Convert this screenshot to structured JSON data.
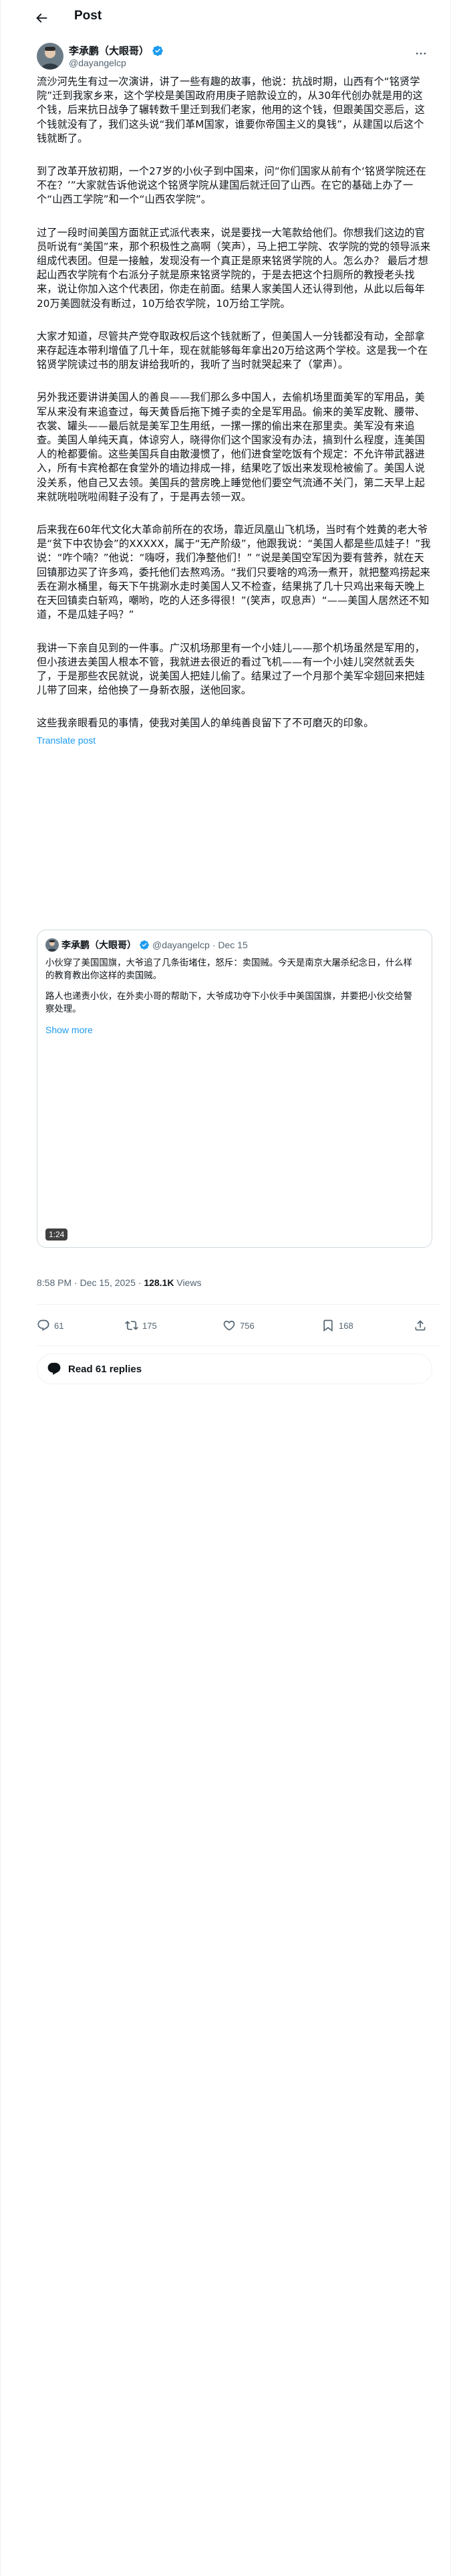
{
  "topbar": {
    "title": "Post"
  },
  "author": {
    "name": "李承鹏（大眼哥）",
    "handle": "@dayangelcp"
  },
  "post": {
    "paragraphs": [
      "流沙河先生有过一次演讲，讲了一些有趣的故事，他说：抗战时期，山西有个“铭贤学院”迁到我家乡来，这个学校是美国政府用庚子赔款设立的，从30年代创办就是用的这个钱，后来抗日战争了辗转数千里迁到我们老家，他用的这个钱，但跟美国交恶后，这个钱就没有了，我们这头说“我们革M国家，谁要你帝国主义的臭钱”，从建国以后这个钱就断了。",
      "到了改革开放初期，一个27岁的小伙子到中国来，问“你们国家从前有个‘铭贤学院还在不在？’”大家就告诉他说这个铭贤学院从建国后就迁回了山西。在它的基础上办了一个“山西工学院”和一个“山西农学院”。",
      "过了一段时间美国方面就正式派代表来，说是要找一大笔款给他们。你想我们这边的官员听说有“美国”来，那个积极性之高啊（笑声），马上把工学院、农学院的党的领导派来组成代表团。但是一接触，发现没有一个真正是原来铭贤学院的人。怎么办？ 最后才想起山西农学院有个右派分子就是原来铭贤学院的，于是去把这个扫厕所的教授老头找来，说让你加入这个代表团，你走在前面。结果人家美国人还认得到他，从此以后每年20万美圆就没有断过，10万给农学院，10万给工学院。",
      "大家才知道，尽管共产党夺取政权后这个钱就断了，但美国人一分钱都没有动，全部拿来存起连本带利增值了几十年，现在就能够每年拿出20万给这两个学校。这是我一个在铭贤学院读过书的朋友讲给我听的，我听了当时就哭起来了（掌声）。",
      "另外我还要讲讲美国人的善良——我们那么多中国人，去偷机场里面美军的军用品，美军从来没有来追查过，每天黄昏后拖下摊子卖的全是军用品。偷来的美军皮靴、腰带、衣裳、罐头——最后就是美军卫生用纸，一摞一摞的偷出来在那里卖。美军没有来追查。美国人单纯天真，体谅穷人，晓得你们这个国家没有办法，搞到什么程度，连美国人的枪都要偷。这些美国兵自由散漫惯了，他们进食堂吃饭有个规定：不允许带武器进入，所有卡宾枪都在食堂外的墙边排成一排，结果吃了饭出来发现枪被偷了。美国人说没关系，他自己又去领。美国兵的营房晚上睡觉他们要空气流通不关门，第二天早上起来就咣啦咣啦闹鞋子没有了，于是再去领一双。",
      "后来我在60年代文化大革命前所在的农场，靠近凤凰山飞机场，当时有个姓黄的老大爷是“贫下中农协会”的XXXXX，属于“无产阶级”，他跟我说：“美国人都是些瓜娃子！”我说：“咋个喃？”他说：“嗨呀，我们净整他们！” “说是美国空军因为要有营养，就在天回镇那边买了许多鸡，委托他们去熬鸡汤。“我们只要啥的鸡汤一煮开，就把整鸡捞起来丢在涮水桶里，每天下午挑涮水走时美国人又不检查，结果挑了几十只鸡出来每天晚上在天回镇卖白斩鸡，嘲哟，吃的人还多得很！”(笑声，叹息声）“——美国人居然还不知道，不是瓜娃子吗？”",
      "我讲一下亲自见到的一件事。广汉机场那里有一个小娃儿——那个机场虽然是军用的，但小孩进去美国人根本不管，我就进去很近的看过飞机——有一个小娃儿突然就丢失了，于是那些农民就说，说美国人把娃儿偷了。结果过了一个月那个美军伞翅回来把娃儿带了回来，给他换了一身新衣服，送他回家。",
      "这些我亲眼看见的事情，使我对美国人的单纯善良留下了不可磨灭的印象。"
    ],
    "translate_label": "Translate post",
    "timestamp": "8:58 PM · Dec 15, 2025 · ",
    "views_count": "128.1K",
    "views_label": " Views"
  },
  "quote": {
    "name": "李承鹏（大眼哥）",
    "handle": "@dayangelcp",
    "date": "· Dec 15",
    "paragraphs": [
      "小伙穿了美国国旗，大爷追了几条街堵住，怒斥：卖国贼。今天是南京大屠杀纪念日，什么样的教育教出你这样的卖国贼。",
      "路人也递责小伙，在外卖小哥的帮助下，大爷成功夺下小伙手中美国国旗，并要把小伙交给警察处理。"
    ],
    "show_more": "Show more",
    "duration": "1:24"
  },
  "actions": {
    "replies": "61",
    "reposts": "175",
    "likes": "756",
    "bookmarks": "168"
  },
  "read_replies": "Read 61 replies",
  "colors": {
    "accent": "#1d9bf0",
    "muted": "#536471",
    "border": "#eff3f4",
    "avatar_bg": "#5b6e7a"
  }
}
